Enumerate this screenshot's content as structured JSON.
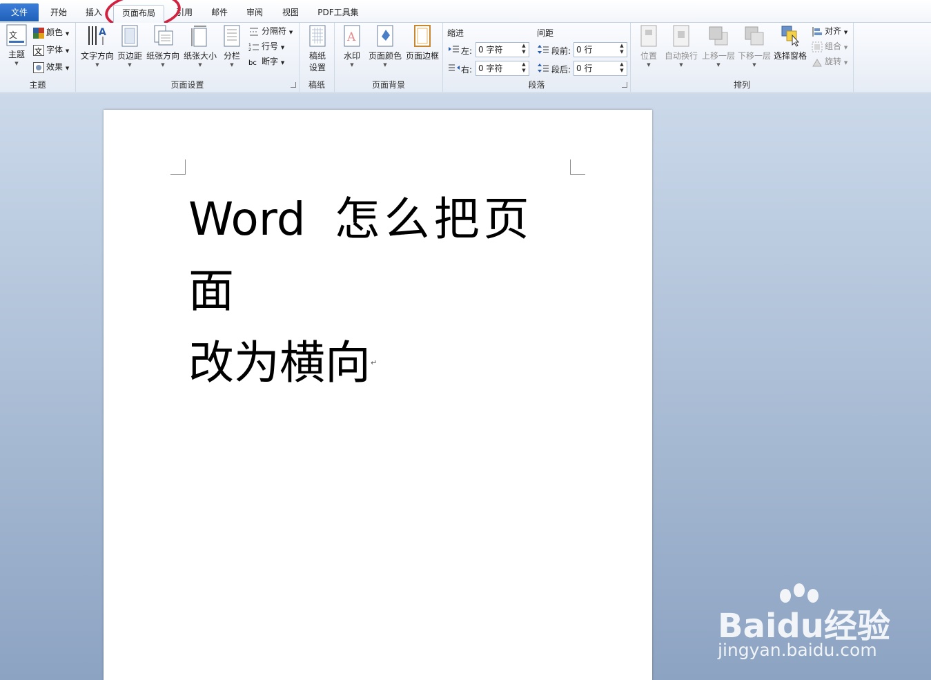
{
  "tabs": [
    {
      "label": "文件",
      "active": false
    },
    {
      "label": "开始",
      "active": false
    },
    {
      "label": "插入",
      "active": false
    },
    {
      "label": "页面布局",
      "active": true
    },
    {
      "label": "引用",
      "active": false
    },
    {
      "label": "邮件",
      "active": false
    },
    {
      "label": "审阅",
      "active": false
    },
    {
      "label": "视图",
      "active": false
    },
    {
      "label": "PDF工具集",
      "active": false
    }
  ],
  "ribbon": {
    "theme": {
      "group_label": "主题",
      "theme_btn": "主题",
      "colors": "颜色",
      "fonts": "字体",
      "effects": "效果"
    },
    "page_setup": {
      "group_label": "页面设置",
      "text_direction": "文字方向",
      "margins": "页边距",
      "orientation": "纸张方向",
      "size": "纸张大小",
      "columns": "分栏",
      "breaks": "分隔符",
      "line_numbers": "行号",
      "hyphenation": "断字"
    },
    "draft": {
      "group_label": "稿纸",
      "draft_setup_line1": "稿纸",
      "draft_setup_line2": "设置"
    },
    "background": {
      "group_label": "页面背景",
      "watermark": "水印",
      "page_color": "页面颜色",
      "page_borders": "页面边框"
    },
    "paragraph": {
      "group_label": "段落",
      "indent_title": "缩进",
      "left_label": "左:",
      "left_value": "0 字符",
      "right_label": "右:",
      "right_value": "0 字符",
      "spacing_title": "间距",
      "before_label": "段前:",
      "before_value": "0 行",
      "after_label": "段后:",
      "after_value": "0 行"
    },
    "arrange": {
      "group_label": "排列",
      "position": "位置",
      "wrap_text": "自动换行",
      "bring_forward": "上移一层",
      "send_backward": "下移一层",
      "selection_pane": "选择窗格",
      "align": "对齐",
      "group": "组合",
      "rotate": "旋转"
    }
  },
  "document": {
    "line1_word": "Word",
    "line1_rest": "怎么把页面",
    "line2": "改为横向",
    "para_mark": "↵"
  },
  "watermark": {
    "logo": "Baidu经验",
    "url": "jingyan.baidu.com"
  },
  "colors": {
    "file_tab": "#2a6cc6",
    "annotation": "#d0213f",
    "workspace_top": "#cbd9ea",
    "workspace_bottom": "#8ca3c2"
  }
}
